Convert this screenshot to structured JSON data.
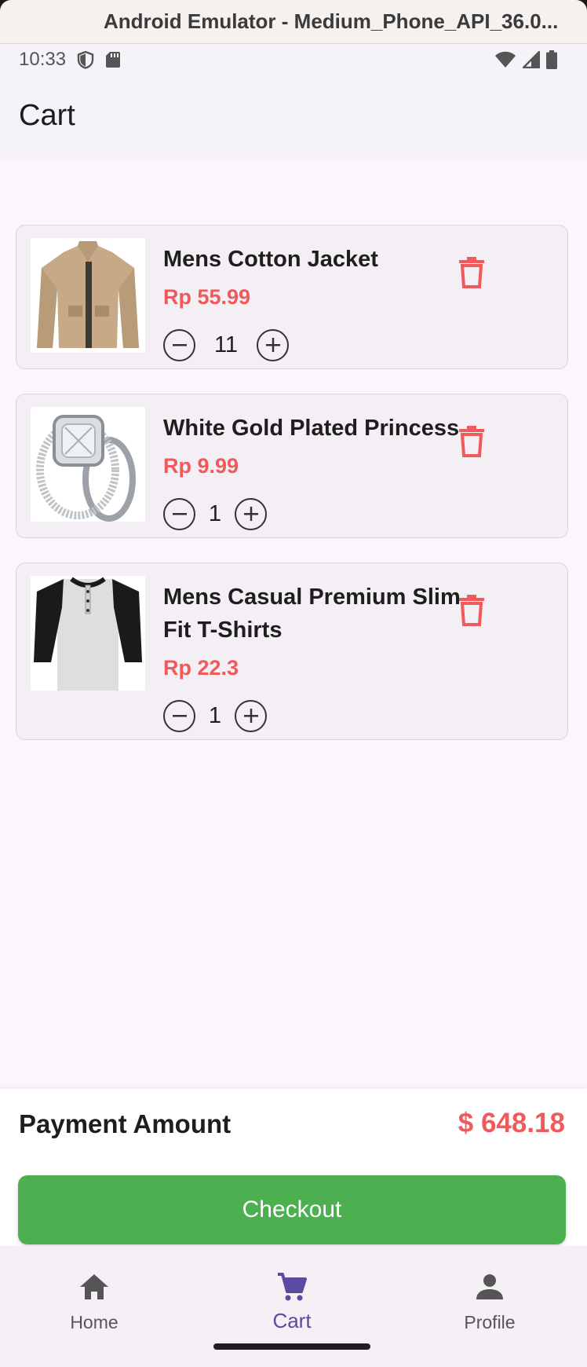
{
  "window": {
    "title": "Android Emulator - Medium_Phone_API_36.0..."
  },
  "status_bar": {
    "time": "10:33"
  },
  "app_bar": {
    "title": "Cart"
  },
  "cart": {
    "items": [
      {
        "name": "Mens Cotton Jacket",
        "price": "Rp 55.99",
        "quantity": "11",
        "image": "jacket-image"
      },
      {
        "name": "White Gold Plated Princess",
        "price": "Rp 9.99",
        "quantity": "1",
        "image": "ring-image"
      },
      {
        "name": "Mens Casual Premium Slim Fit T-Shirts",
        "price": "Rp 22.3",
        "quantity": "1",
        "image": "tshirt-image"
      }
    ]
  },
  "payment": {
    "label": "Payment Amount",
    "amount": "$ 648.18",
    "checkout_label": "Checkout"
  },
  "nav": {
    "items": [
      {
        "label": "Home",
        "icon": "home-icon"
      },
      {
        "label": "Cart",
        "icon": "cart-icon",
        "active": true
      },
      {
        "label": "Profile",
        "icon": "person-icon"
      }
    ]
  },
  "colors": {
    "price": "#f05a5a",
    "checkout": "#4caf50",
    "nav_active": "#5a4ba0",
    "delete": "#f05a5a"
  }
}
